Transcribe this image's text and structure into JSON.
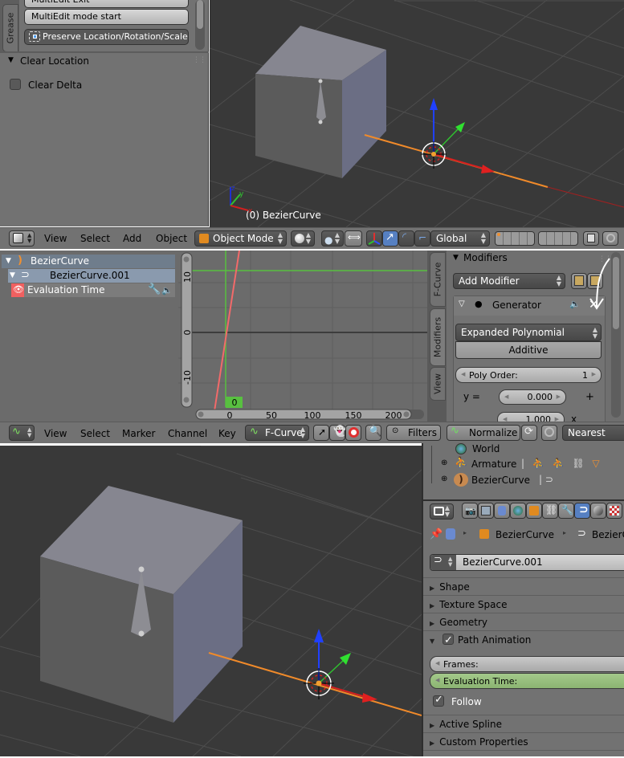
{
  "toolshelf": {
    "tab_label": "Grease",
    "buttons": [
      {
        "label": "MultiEdit Exit"
      },
      {
        "label": "MultiEdit mode start"
      },
      {
        "label": "Preserve Location/Rotation/Scale",
        "icon": "transform-icon"
      }
    ],
    "operator_panel": {
      "title": "Clear Location",
      "options": [
        {
          "label": "Clear Delta",
          "checked": false
        }
      ]
    }
  },
  "viewport_top": {
    "object_info": "(0) BezierCurve",
    "axis_labels": {
      "x": "x",
      "y": "y",
      "z": "z"
    }
  },
  "viewport_header": {
    "editor_icon": "3d-view-icon",
    "menus": [
      "View",
      "Select",
      "Add",
      "Object"
    ],
    "mode": "Object Mode",
    "transform_orientation": "Global"
  },
  "graph_editor": {
    "channels": [
      {
        "label": "BezierCurve",
        "icon": "curve-object-icon",
        "level": 0
      },
      {
        "label": "BezierCurve.001",
        "icon": "curve-data-icon",
        "level": 1
      },
      {
        "label": "Evaluation Time",
        "icon": "eye-icon",
        "level": 2,
        "color": "#f06060"
      }
    ],
    "current_frame": "0",
    "x_ticks": [
      "0",
      "50",
      "100",
      "150",
      "200"
    ],
    "y_ticks": [
      "10",
      "0",
      "-10"
    ],
    "modifiers_panel": {
      "title": "Modifiers",
      "add_modifier_label": "Add Modifier",
      "modifier": {
        "name": "Generator",
        "mode": "Expanded Polynomial",
        "additive_label": "Additive",
        "poly_order_label": "Poly Order:",
        "poly_order_value": "1",
        "y_label": "y =",
        "coef0": "0.000",
        "plus": "+",
        "coef1": "1.000",
        "x_label": "x"
      },
      "side_tabs": [
        "F-Curve",
        "Modifiers",
        "View"
      ]
    },
    "header": {
      "editor_icon": "graph-editor-icon",
      "menus": [
        "View",
        "Select",
        "Marker",
        "Channel",
        "Key"
      ],
      "mode": "F-Curve",
      "filters_label": "Filters",
      "normalize_label": "Normalize",
      "snap_mode": "Nearest Frame"
    }
  },
  "outliner": {
    "items": [
      {
        "label": "World",
        "icon": "world-icon"
      },
      {
        "label": "Armature",
        "icon": "armature-icon"
      },
      {
        "label": "BezierCurve",
        "icon": "curve-object-icon"
      }
    ]
  },
  "properties": {
    "breadcrumb": [
      "BezierCurve",
      "BezierCurve"
    ],
    "datablock_name": "BezierCurve.001",
    "panels": [
      {
        "label": "Shape",
        "expanded": false
      },
      {
        "label": "Texture Space",
        "expanded": false
      },
      {
        "label": "Geometry",
        "expanded": false
      },
      {
        "label": "Path Animation",
        "expanded": true,
        "checked": true
      }
    ],
    "path_animation": {
      "frames_label": "Frames:",
      "eval_time_label": "Evaluation Time:",
      "follow_label": "Follow",
      "follow_checked": true
    },
    "panels_after": [
      {
        "label": "Active Spline",
        "expanded": false
      },
      {
        "label": "Custom Properties",
        "expanded": false
      }
    ]
  },
  "colors": {
    "axis_x": "#d42020",
    "axis_y": "#30c030",
    "axis_z": "#1f3fd8",
    "selected_orange": "#f08a2a",
    "active_blue": "#5680c2",
    "fcurve_red": "#f26a6a",
    "frame_green": "#58c040"
  }
}
